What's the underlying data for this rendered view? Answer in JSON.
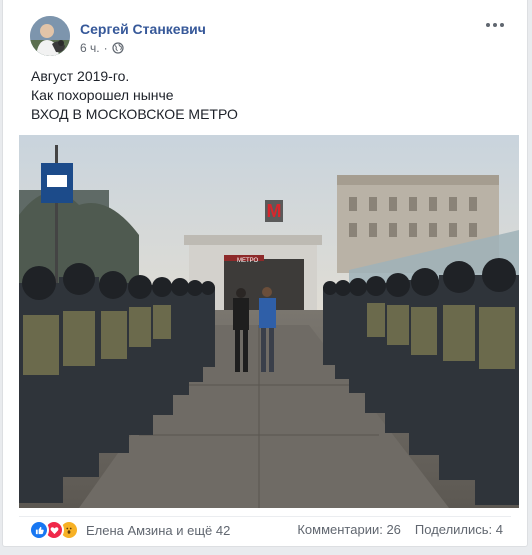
{
  "post": {
    "author": "Сергей Станкевич",
    "timestamp": "6 ч.",
    "privacy_icon": "globe-icon",
    "text_lines": [
      "Август 2019-го.",
      "Как похорошел нынче",
      "ВХОД В МОСКОВСКОЕ МЕТРО"
    ]
  },
  "photo": {
    "metro_letter": "M",
    "station_sign": "МЕТРО"
  },
  "footer": {
    "reactions": [
      "like-icon",
      "love-icon",
      "wow-icon"
    ],
    "reactors": "Елена Амзина и ещё 42",
    "comments": "Комментарии: 26",
    "shares": "Поделились: 4"
  },
  "colors": {
    "link": "#365899",
    "meta": "#616770",
    "like": "#1877f2",
    "love": "#f0284a",
    "wow": "#f7b125"
  }
}
